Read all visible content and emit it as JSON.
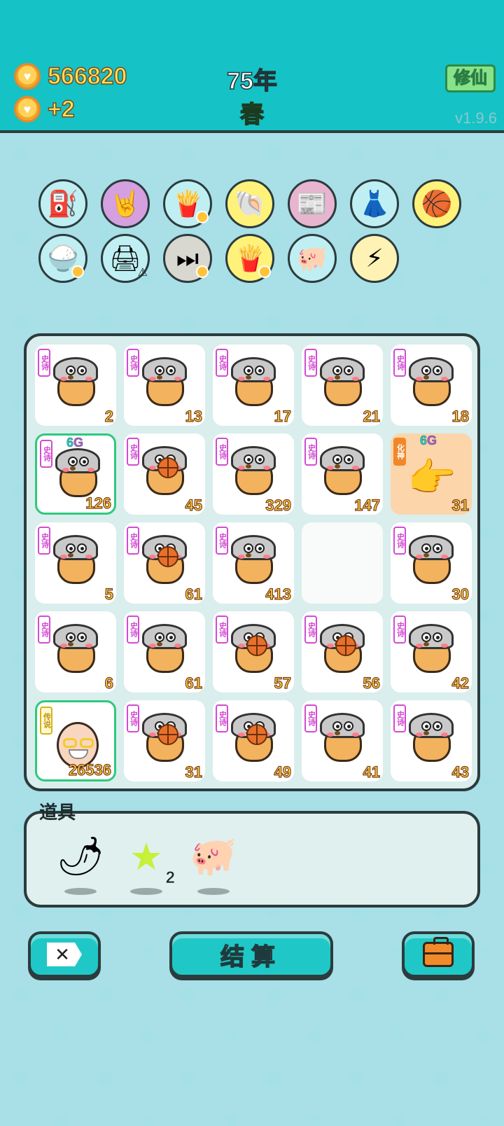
{
  "header": {
    "coins": "566820",
    "income": "+2",
    "year": "75年",
    "season": "春",
    "xiuxian_label": "修仙",
    "version": "v1.9.6"
  },
  "buffs": [
    {
      "name": "pump-icon",
      "bg": "#bfeff2"
    },
    {
      "name": "rock-hand-icon",
      "bg": "#d4a0e0"
    },
    {
      "name": "fries-icon",
      "bg": "#bfeff2"
    },
    {
      "name": "shell-icon",
      "bg": "#fff27a"
    },
    {
      "name": "time-magazine-icon",
      "bg": "#e7b5cf"
    },
    {
      "name": "skirt-icon",
      "bg": "#bfeff2"
    },
    {
      "name": "basketballs-icon",
      "bg": "#fff27a"
    },
    {
      "name": "rice-bowl-icon",
      "bg": "#bfeff2"
    },
    {
      "name": "printer-icon",
      "bg": "#bfeff2"
    },
    {
      "name": "skip-icon",
      "bg": "#d8d8d0"
    },
    {
      "name": "fries-icon",
      "bg": "#fff27a"
    },
    {
      "name": "piggy-bank-icon",
      "bg": "#bfeff2"
    },
    {
      "name": "lightning-icon",
      "bg": "#fff2b5"
    }
  ],
  "board": {
    "badge_epic": "史诗",
    "badge_legend": "传说",
    "badge_huashen": "化神",
    "tag_6": "6",
    "tag_g": "G",
    "cells": [
      {
        "type": "char",
        "value": "2"
      },
      {
        "type": "char",
        "value": "13"
      },
      {
        "type": "char",
        "value": "17"
      },
      {
        "type": "char",
        "value": "21"
      },
      {
        "type": "char",
        "value": "18"
      },
      {
        "type": "char6g",
        "value": "126"
      },
      {
        "type": "charball",
        "value": "45"
      },
      {
        "type": "char",
        "value": "329"
      },
      {
        "type": "char",
        "value": "147"
      },
      {
        "type": "hand",
        "value": "31"
      },
      {
        "type": "char",
        "value": "5"
      },
      {
        "type": "charball",
        "value": "61"
      },
      {
        "type": "char",
        "value": "413"
      },
      {
        "type": "empty",
        "value": ""
      },
      {
        "type": "char",
        "value": "30"
      },
      {
        "type": "char",
        "value": "6"
      },
      {
        "type": "char",
        "value": "61"
      },
      {
        "type": "charball",
        "value": "57"
      },
      {
        "type": "charball",
        "value": "56"
      },
      {
        "type": "char",
        "value": "42"
      },
      {
        "type": "legend",
        "value": "26536"
      },
      {
        "type": "charball",
        "value": "31"
      },
      {
        "type": "charball",
        "value": "49"
      },
      {
        "type": "char",
        "value": "41"
      },
      {
        "type": "char",
        "value": "43"
      }
    ]
  },
  "items": {
    "title": "道具",
    "list": [
      {
        "name": "chili-pepper-icon",
        "count": ""
      },
      {
        "name": "star-icon",
        "count": "2"
      },
      {
        "name": "piggy-bank-icon",
        "count": ""
      }
    ]
  },
  "buttons": {
    "settle_label": "结算"
  }
}
